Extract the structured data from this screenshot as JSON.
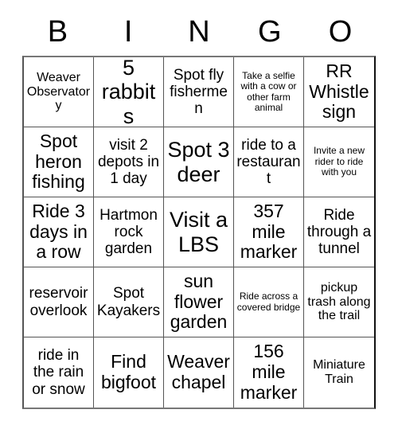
{
  "card": {
    "title_letters": [
      "B",
      "I",
      "N",
      "G",
      "O"
    ],
    "columns": 5,
    "rows": 5,
    "colors": {
      "background": "#ffffff",
      "text": "#000000",
      "grid_line": "#555555"
    },
    "cells": [
      {
        "text": "Weaver Observatory",
        "size": "sm"
      },
      {
        "text": "5 rabbits",
        "size": "xl"
      },
      {
        "text": "Spot fly fishermen",
        "size": "md"
      },
      {
        "text": "Take a selfie with a cow or other farm animal",
        "size": "xs"
      },
      {
        "text": "RR Whistle sign",
        "size": "lg"
      },
      {
        "text": "Spot heron fishing",
        "size": "lg"
      },
      {
        "text": "visit 2 depots in 1 day",
        "size": "md"
      },
      {
        "text": "Spot 3 deer",
        "size": "xl"
      },
      {
        "text": "ride to a restaurant",
        "size": "md"
      },
      {
        "text": "Invite a new rider to ride with you",
        "size": "xs"
      },
      {
        "text": "Ride 3 days in a row",
        "size": "lg"
      },
      {
        "text": "Hartmon rock garden",
        "size": "md"
      },
      {
        "text": "Visit a LBS",
        "size": "xl"
      },
      {
        "text": "357 mile marker",
        "size": "lg"
      },
      {
        "text": "Ride through a tunnel",
        "size": "md"
      },
      {
        "text": "reservoir overlook",
        "size": "md"
      },
      {
        "text": "Spot Kayakers",
        "size": "md"
      },
      {
        "text": "sun flower garden",
        "size": "lg"
      },
      {
        "text": "Ride across a covered bridge",
        "size": "xs"
      },
      {
        "text": "pickup trash along the trail",
        "size": "sm"
      },
      {
        "text": "ride in the rain or snow",
        "size": "md"
      },
      {
        "text": "Find bigfoot",
        "size": "lg"
      },
      {
        "text": "Weaver chapel",
        "size": "lg"
      },
      {
        "text": "156 mile marker",
        "size": "lg"
      },
      {
        "text": "Miniature Train",
        "size": "sm"
      }
    ]
  }
}
